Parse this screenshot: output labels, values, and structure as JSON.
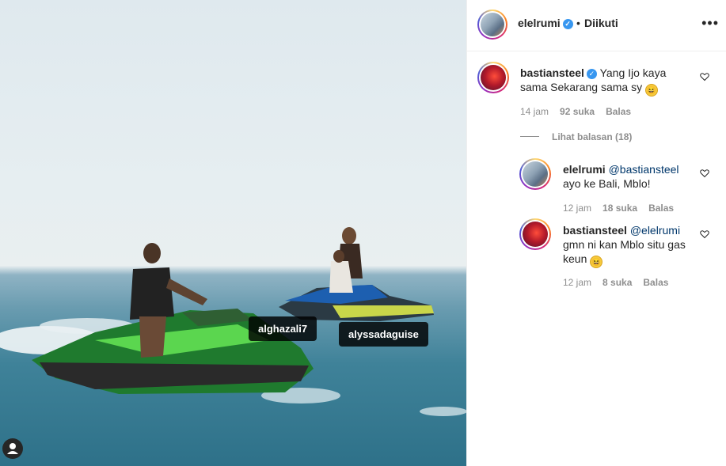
{
  "photo": {
    "tags": [
      "alghazali7",
      "alyssadaguise"
    ]
  },
  "header": {
    "username": "elelrumi",
    "verified": true,
    "separator": "•",
    "follow_label": "Diikuti",
    "more_icon": "more-horizontal-icon"
  },
  "comment": {
    "username": "bastiansteel",
    "verified": true,
    "line1": "Yang Ijo kaya",
    "line2": "sama Sekarang sama sy",
    "emoji": "🤣",
    "time": "14 jam",
    "likes": "92 suka",
    "reply_label": "Balas"
  },
  "view_replies_label": "Lihat balasan (18)",
  "replies": [
    {
      "username": "elelrumi",
      "mention": "@bastiansteel",
      "text": "ayo ke Bali, Mblo!",
      "time": "12 jam",
      "likes": "18 suka",
      "reply_label": "Balas"
    },
    {
      "username": "bastiansteel",
      "mention": "@elelrumi",
      "line1": "gmn ni kan Mblo situ gas",
      "line2": "keun",
      "emoji": "😆",
      "time": "12 jam",
      "likes": "8 suka",
      "reply_label": "Balas"
    }
  ],
  "colors": {
    "verified_badge": "#3897f0",
    "mention": "#00376b",
    "secondary_text": "#8e8e8e"
  }
}
